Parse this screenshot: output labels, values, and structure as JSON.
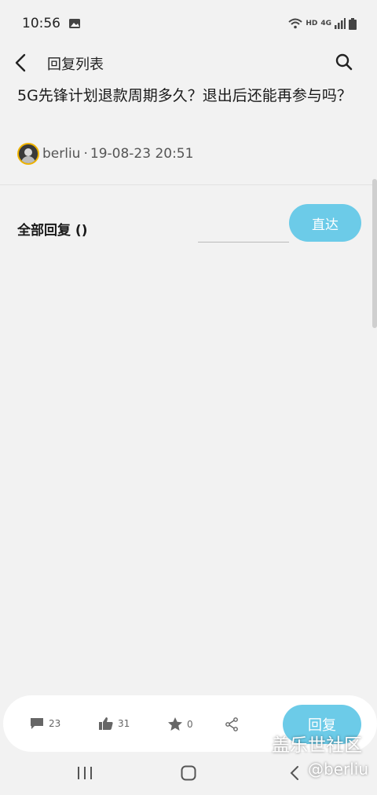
{
  "status_bar": {
    "time": "10:56",
    "hd_label": "HD",
    "network_label": "4G"
  },
  "header": {
    "title": "回复列表",
    "icons": {
      "back": "back-icon",
      "search": "search-icon"
    }
  },
  "post": {
    "title": "5G先锋计划退款周期多久？退出后还能再参与吗？",
    "author": "berliu",
    "separator": "·",
    "date": "19-08-23 20:51"
  },
  "replies": {
    "label": "全部回复 ()",
    "jump_input_value": "",
    "jump_button_label": "直达"
  },
  "bottom_bar": {
    "comments_count": "23",
    "likes_count": "31",
    "favorites_count": "0",
    "reply_button_label": "回复",
    "icons": {
      "comments": "comment-icon",
      "likes": "thumbs-up-icon",
      "favorites": "star-icon",
      "share": "share-icon"
    }
  },
  "watermark": {
    "brand": "盖乐世社区",
    "handle": "@berliu"
  },
  "colors": {
    "accent": "#6ccbe8",
    "background": "#f2f2f2",
    "avatar_ring": "#f0b400"
  }
}
